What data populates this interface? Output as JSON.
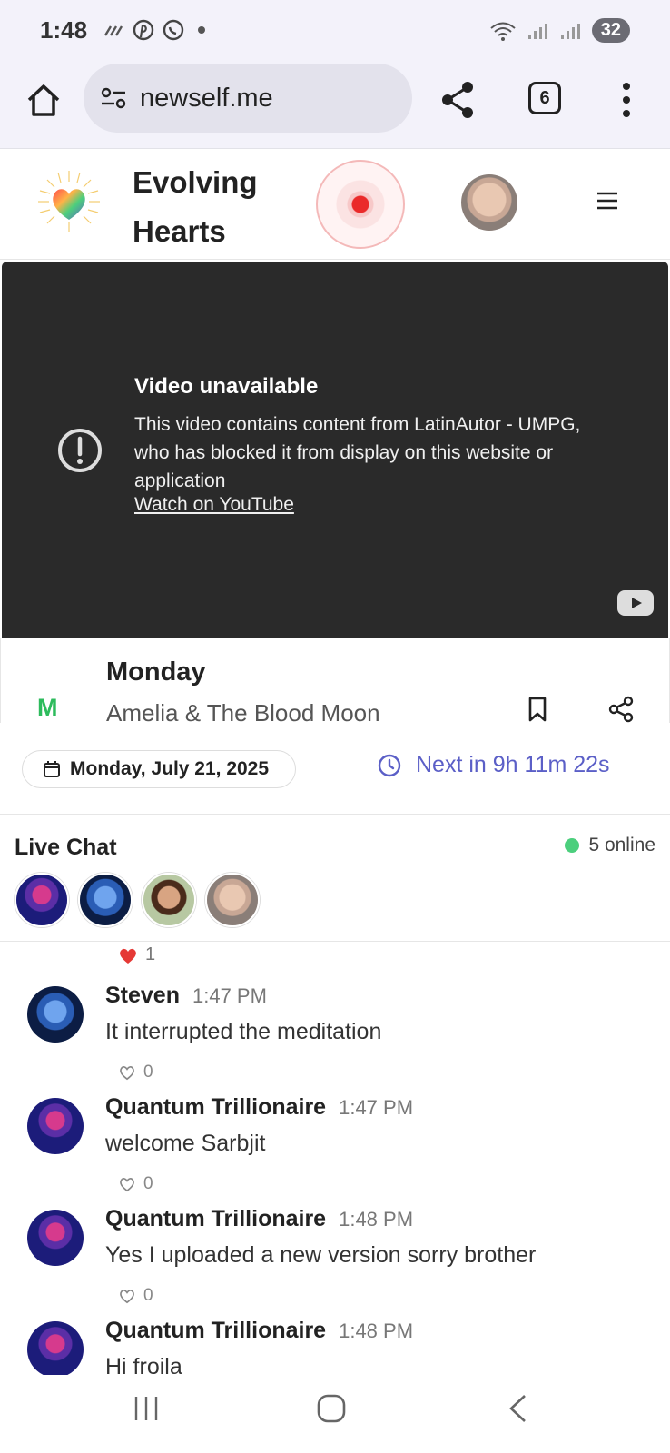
{
  "status_bar": {
    "time": "1:48",
    "battery": "32",
    "notification_icons": [
      "signal-off-icon",
      "pinterest-icon",
      "whatsapp-icon",
      "dot-icon"
    ],
    "right_icons": [
      "wifi-icon",
      "cell-signal-icon",
      "cell-signal-icon"
    ]
  },
  "browser": {
    "url": "newself.me",
    "tab_count": "6"
  },
  "site": {
    "title": "Evolving Hearts"
  },
  "video": {
    "title": "Video unavailable",
    "message": "This video contains content from LatinAutor - UMPG, who has blocked it from display on this website or application",
    "link": "Watch on YouTube"
  },
  "track": {
    "initial": "M",
    "day": "Monday",
    "name": "Amelia & The Blood Moon",
    "initial_color": "#2dbb5c"
  },
  "schedule": {
    "date": "Monday, July 21, 2025",
    "countdown": "Next in 9h 11m 22s",
    "accent_color": "#5b5fc7"
  },
  "chat": {
    "title": "Live Chat",
    "online": "5 online",
    "top_likes": "1",
    "messages": [
      {
        "name": "Steven",
        "time": "1:47 PM",
        "text": "It interrupted the meditation",
        "likes": "0"
      },
      {
        "name": "Quantum Trillionaire",
        "time": "1:47 PM",
        "text": "welcome Sarbjit",
        "likes": "0"
      },
      {
        "name": "Quantum Trillionaire",
        "time": "1:48 PM",
        "text": "Yes I uploaded a new version sorry brother",
        "likes": "0"
      },
      {
        "name": "Quantum Trillionaire",
        "time": "1:48 PM",
        "text": "Hi froila",
        "likes": ""
      }
    ]
  }
}
